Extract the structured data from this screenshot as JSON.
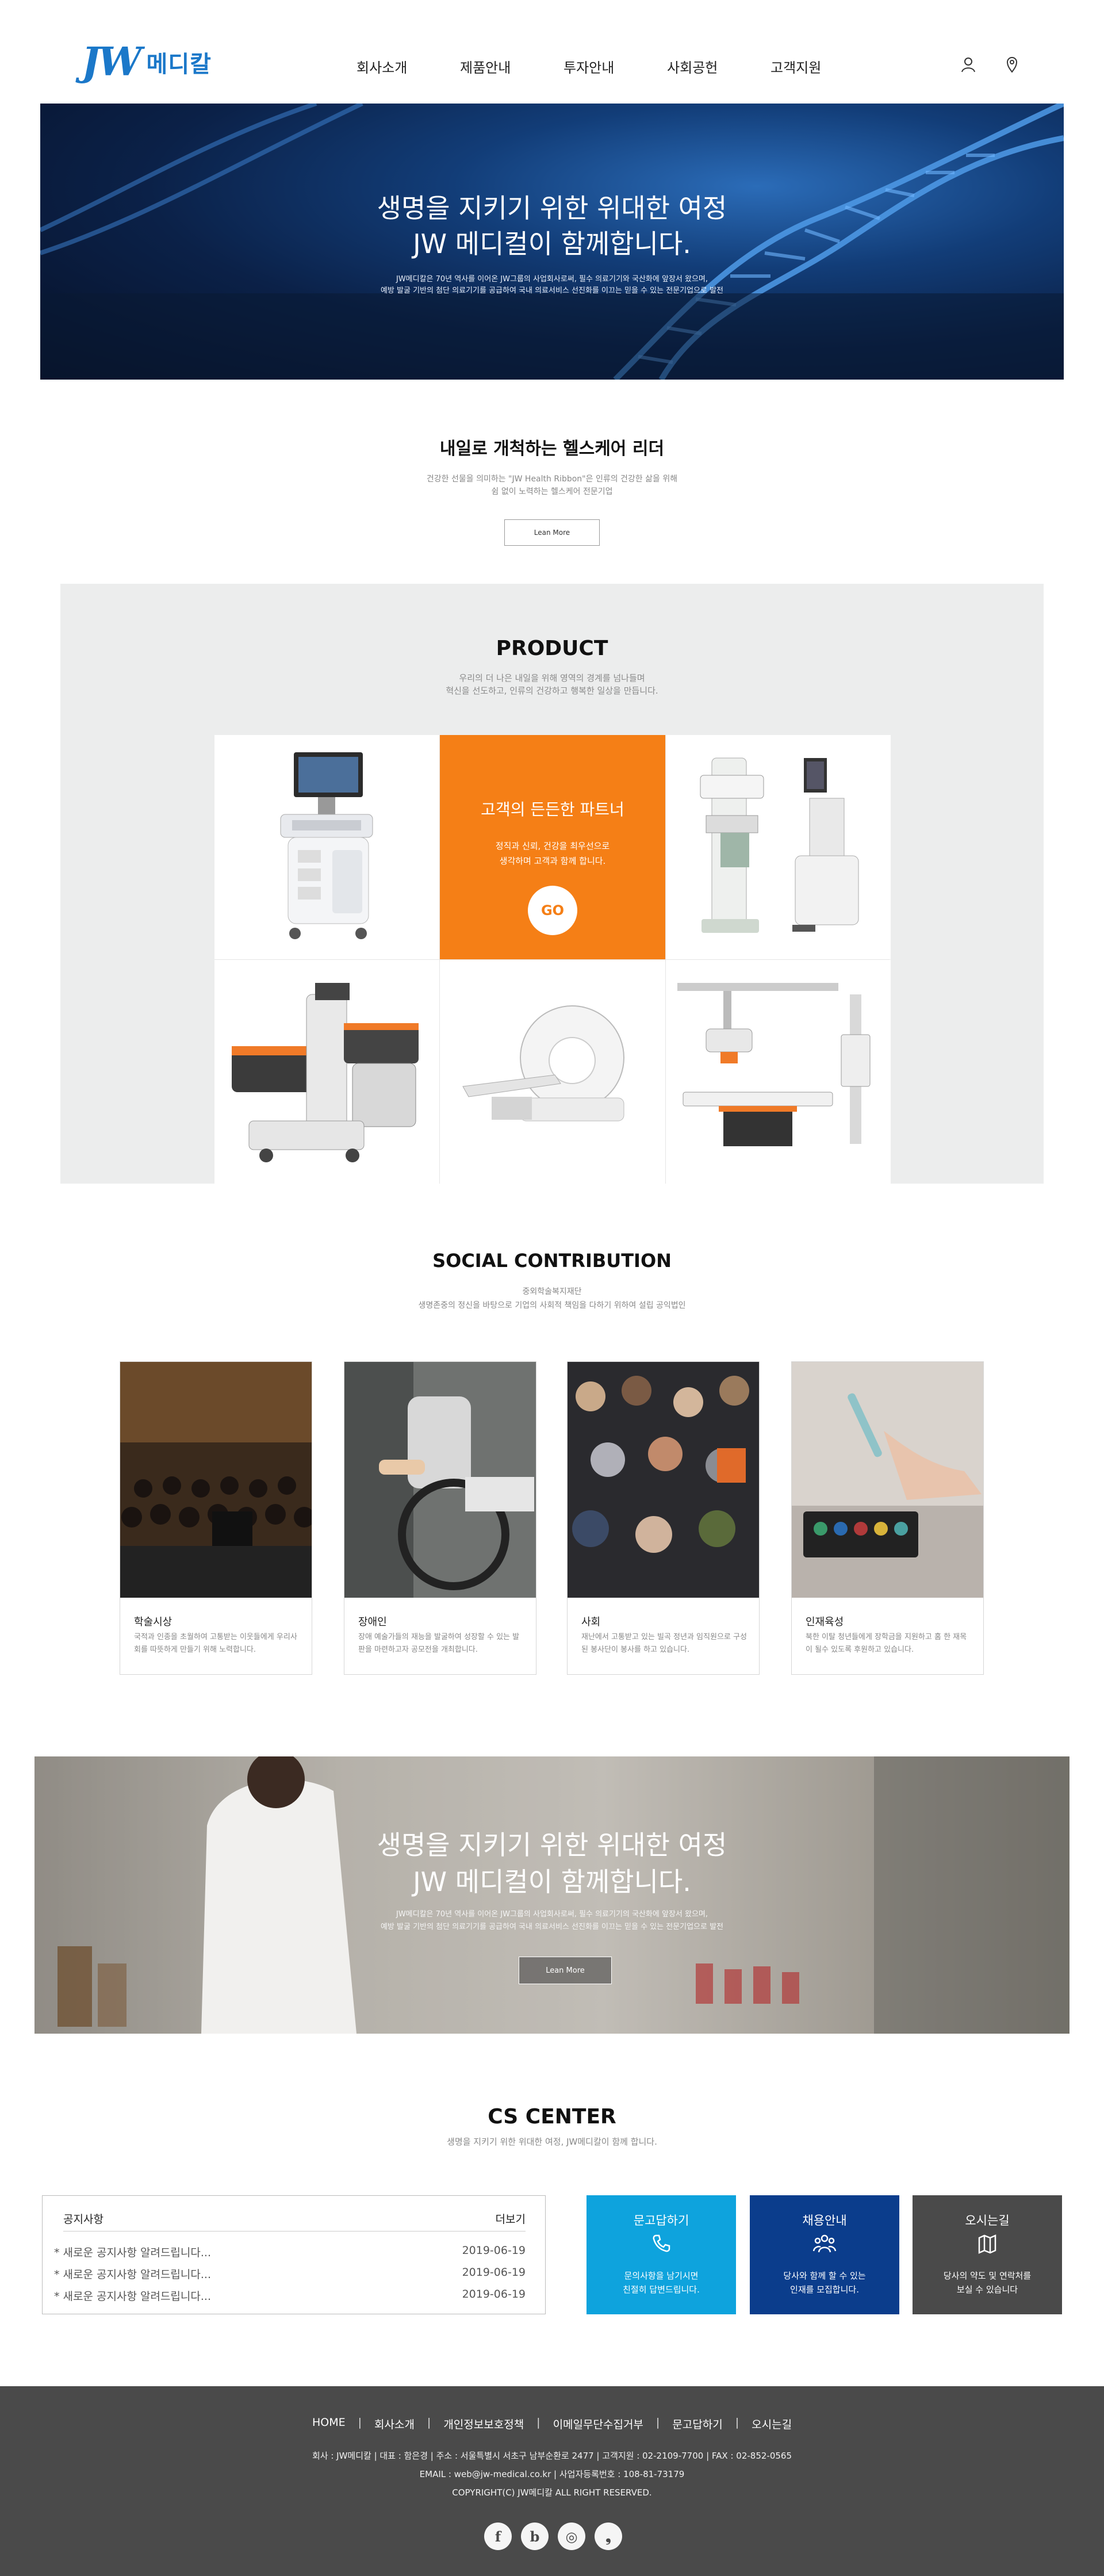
{
  "header": {
    "logo_mark": "JW",
    "logo_text": "메디칼",
    "nav": [
      "회사소개",
      "제품안내",
      "투자안내",
      "사회공헌",
      "고객지원"
    ],
    "icons": [
      "user-icon",
      "location-pin-icon"
    ]
  },
  "hero": {
    "title_line1": "생명을 지키기 위한 위대한 여정",
    "title_line2": "JW 메디컬이 함께합니다.",
    "sub_line1": "JW메디칼은 70년 역사를 이어온 JW그룹의 사업회사로써, 필수 의료기기와 국산화에 앞장서 왔으며,",
    "sub_line2": "예방 발굴 기반의 첨단 의료기기를 공급하여 국내 의료서비스 선진화를 이끄는 믿을 수 있는 전문기업으로 발전"
  },
  "intro": {
    "title": "내일로 개척하는 헬스케어 리더",
    "sub_line1": "건강한 선물을 의미하는 \"JW Health Ribbon\"은 인류의 건강한 삶을 위해",
    "sub_line2": "쉼 없이 노력하는 헬스케어 전문기업",
    "button": "Lean More"
  },
  "product": {
    "title": "PRODUCT",
    "sub_line1": "우리의 더 나은 내일을 위해 영역의 경계를 넘나들며",
    "sub_line2": "혁신을 선도하고, 인류의 건강하고 행복한 일상을 만듭니다.",
    "promo_title": "고객의 든든한 파트너",
    "promo_sub_line1": "정직과 신뢰, 건강을 최우선으로",
    "promo_sub_line2": "생각하며 고객과 함께 합니다.",
    "promo_button": "GO",
    "items": [
      "ultrasound-system",
      "mammography-system",
      "c-arm-system",
      "ct-scanner",
      "x-ray-system"
    ]
  },
  "social": {
    "title": "SOCIAL CONTRIBUTION",
    "sub_line1": "중외학술복지재단",
    "sub_line2": "생명존중의 정신을 바탕으로 기업의 사회적 책임을 다하기 위하여 설립 공익법인",
    "cards": [
      {
        "title": "학술시상",
        "text": "국적과 인종을 초월하여 고통받는 이웃들에게 우리사회를 따뜻하게 만들기 위해 노력합니다."
      },
      {
        "title": "장애인",
        "text": "장애 예술가들의 재능을 발굴하여 성장할 수 있는 발판을 마련하고자 공모전을 개최합니다."
      },
      {
        "title": "사회",
        "text": "재난에서 고통받고 있는 빌곡 정년과 임직원으로 구성된 봉사단이 봉사를 하고 있습니다."
      },
      {
        "title": "인재육성",
        "text": "북한 이탈 청년들에게 장학금을 지원하고 홈 한 재목이 될수 있도록 후원하고 있습니다."
      }
    ]
  },
  "banner2": {
    "title_line1": "생명을 지키기 위한 위대한 여정",
    "title_line2": "JW 메디컬이 함께합니다.",
    "sub_line1": "JW메디칼은 70년 역사를 이어온 JW그룹의 사업회사로써, 필수 의료기기의 국산화에 앞장서 왔으며,",
    "sub_line2": "예방 발굴 기반의 첨단 의료기기를 공급하여 국내 의료서비스 선진화를 이끄는 믿을 수 있는 전문기업으로 발전",
    "button": "Lean More"
  },
  "cs": {
    "title": "CS CENTER",
    "sub": "생명을 지키기 위한 위대한 여정, JW메디칼이 함께 합니다.",
    "notice_title": "공지사항",
    "notice_more": "더보기",
    "notices": [
      {
        "title": "* 새로운 공지사항 알려드립니다...",
        "date": "2019-06-19"
      },
      {
        "title": "* 새로운 공지사항 알려드립니다...",
        "date": "2019-06-19"
      },
      {
        "title": "* 새로운 공지사항 알려드립니다...",
        "date": "2019-06-19"
      }
    ],
    "boxes": [
      {
        "title": "문고답하기",
        "line1": "문의사항을 남기시면",
        "line2": "친절히 답변드립니다.",
        "color": "#0ea3dd",
        "icon": "phone-icon"
      },
      {
        "title": "채용안내",
        "line1": "당사와 함께 할 수 있는",
        "line2": "인재를 모집합니다.",
        "color": "#0b3d8c",
        "icon": "people-icon"
      },
      {
        "title": "오시는길",
        "line1": "당사의 약도 및 연락처를",
        "line2": "보실 수 있습니다",
        "color": "#4a4a4a",
        "icon": "map-icon"
      }
    ]
  },
  "footer": {
    "nav": [
      "HOME",
      "회사소개",
      "개인정보보호정책",
      "이메일무단수집거부",
      "문고답하기",
      "오시는길"
    ],
    "info_line1": "회사 : JW메디칼 | 대표 : 함은경 | 주소 : 서울특별시 서초구 남부순환로 2477 | 고객지원 : 02-2109-7700 | FAX : 02-852-0565",
    "info_line2": "EMAIL : web@jw-medical.co.kr | 사업자등록번호 : 108-81-73179",
    "info_line3": "COPYRIGHT(C) JW메디칼 ALL RIGHT RESERVED.",
    "social": [
      "f",
      "b",
      "◎",
      "❟"
    ]
  }
}
